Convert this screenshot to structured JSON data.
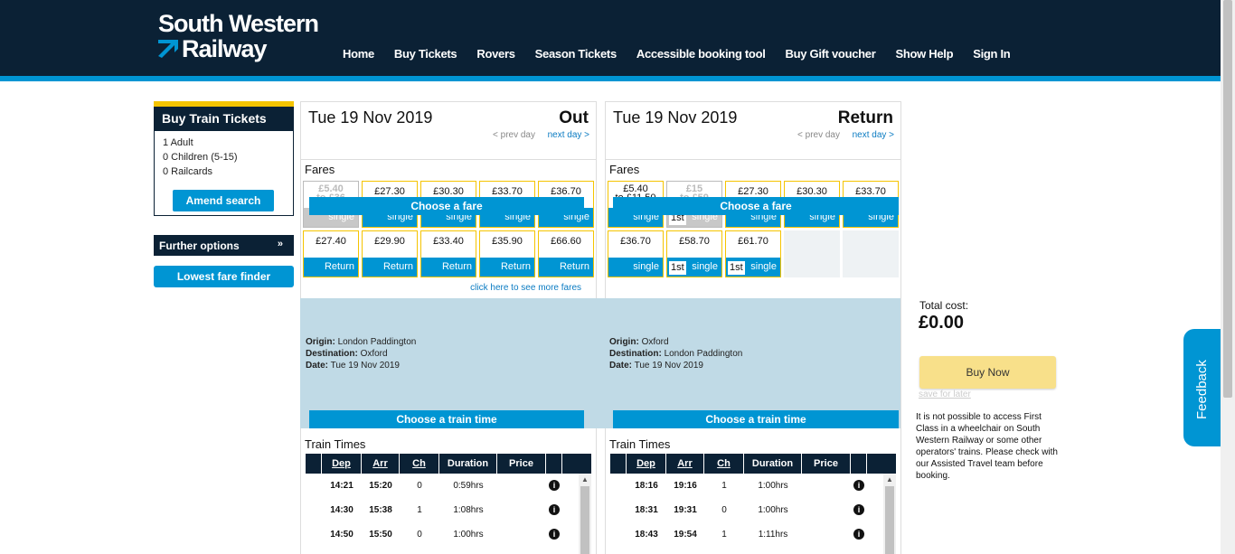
{
  "header": {
    "logo_line1": "South Western",
    "logo_line2": "Railway",
    "nav": [
      "Home",
      "Buy Tickets",
      "Rovers",
      "Season Tickets",
      "Accessible booking tool",
      "Buy Gift voucher",
      "Show Help",
      "Sign In"
    ]
  },
  "sidebar": {
    "title": "Buy Train Tickets",
    "adults": "1 Adult",
    "children": "0 Children (5-15)",
    "railcards": "0 Railcards",
    "amend_label": "Amend search",
    "further_label": "Further options",
    "further_icon": "chevron-double-down-icon",
    "lowest_label": "Lowest fare finder"
  },
  "outbound": {
    "date": "Tue 19 Nov 2019",
    "direction": "Out",
    "prev": "< prev day",
    "next": "next day >",
    "fares_label": "Fares",
    "fares": [
      {
        "price": "£5.40\nto £36",
        "type": "single",
        "disabled": true
      },
      {
        "price": "£27.30",
        "type": "single"
      },
      {
        "price": "£30.30",
        "type": "single"
      },
      {
        "price": "£33.70",
        "type": "single"
      },
      {
        "price": "£36.70",
        "type": "single"
      },
      {
        "price": "£27.40",
        "type": "Return"
      },
      {
        "price": "£29.90",
        "type": "Return"
      },
      {
        "price": "£33.40",
        "type": "Return"
      },
      {
        "price": "£35.90",
        "type": "Return"
      },
      {
        "price": "£66.60",
        "type": "Return"
      }
    ],
    "more_fares": "click here to see more fares",
    "choose_fare": "Choose a fare",
    "origin_label": "Origin:",
    "origin": "London Paddington",
    "destination_label": "Destination:",
    "destination": "Oxford",
    "date_label": "Date:",
    "summary_date": "Tue 19 Nov 2019",
    "choose_time": "Choose a train time",
    "times_label": "Train Times",
    "columns": [
      "Dep",
      "Arr",
      "Ch",
      "Duration",
      "Price"
    ],
    "rows": [
      {
        "dep": "14:21",
        "arr": "15:20",
        "ch": "0",
        "duration": "0:59hrs"
      },
      {
        "dep": "14:30",
        "arr": "15:38",
        "ch": "1",
        "duration": "1:08hrs"
      },
      {
        "dep": "14:50",
        "arr": "15:50",
        "ch": "0",
        "duration": "1:00hrs"
      }
    ]
  },
  "return": {
    "date": "Tue 19 Nov 2019",
    "direction": "Return",
    "prev": "< prev day",
    "next": "next day >",
    "fares_label": "Fares",
    "fares": [
      {
        "price": "£5.40\nto £11.50",
        "type": "single"
      },
      {
        "price": "£15\nto £59",
        "type": "single",
        "disabled": true,
        "first": "1st"
      },
      {
        "price": "£27.30",
        "type": "single"
      },
      {
        "price": "£30.30",
        "type": "single"
      },
      {
        "price": "£33.70",
        "type": "single"
      },
      {
        "price": "£36.70",
        "type": "single"
      },
      {
        "price": "£58.70",
        "type": "single",
        "first": "1st"
      },
      {
        "price": "£61.70",
        "type": "single",
        "first": "1st"
      }
    ],
    "choose_fare": "Choose a fare",
    "origin_label": "Origin:",
    "origin": "Oxford",
    "destination_label": "Destination:",
    "destination": "London Paddington",
    "date_label": "Date:",
    "summary_date": "Tue 19 Nov 2019",
    "choose_time": "Choose a train time",
    "times_label": "Train Times",
    "columns": [
      "Dep",
      "Arr",
      "Ch",
      "Duration",
      "Price"
    ],
    "rows": [
      {
        "dep": "18:16",
        "arr": "19:16",
        "ch": "1",
        "duration": "1:00hrs"
      },
      {
        "dep": "18:31",
        "arr": "19:31",
        "ch": "0",
        "duration": "1:00hrs"
      },
      {
        "dep": "18:43",
        "arr": "19:54",
        "ch": "1",
        "duration": "1:11hrs"
      }
    ]
  },
  "checkout": {
    "total_label": "Total cost:",
    "total": "£0.00",
    "buy_now": "Buy Now",
    "save_later": "save for later",
    "wheelchair_note": "It is not possible to access First Class in a wheelchair on South Western Railway or some other operators' trains. Please check with our Assisted Travel team before booking.",
    "feedback": "Feedback"
  },
  "colors": {
    "navy": "#0b2135",
    "accent": "#0095d3",
    "gold": "#f5c400"
  }
}
